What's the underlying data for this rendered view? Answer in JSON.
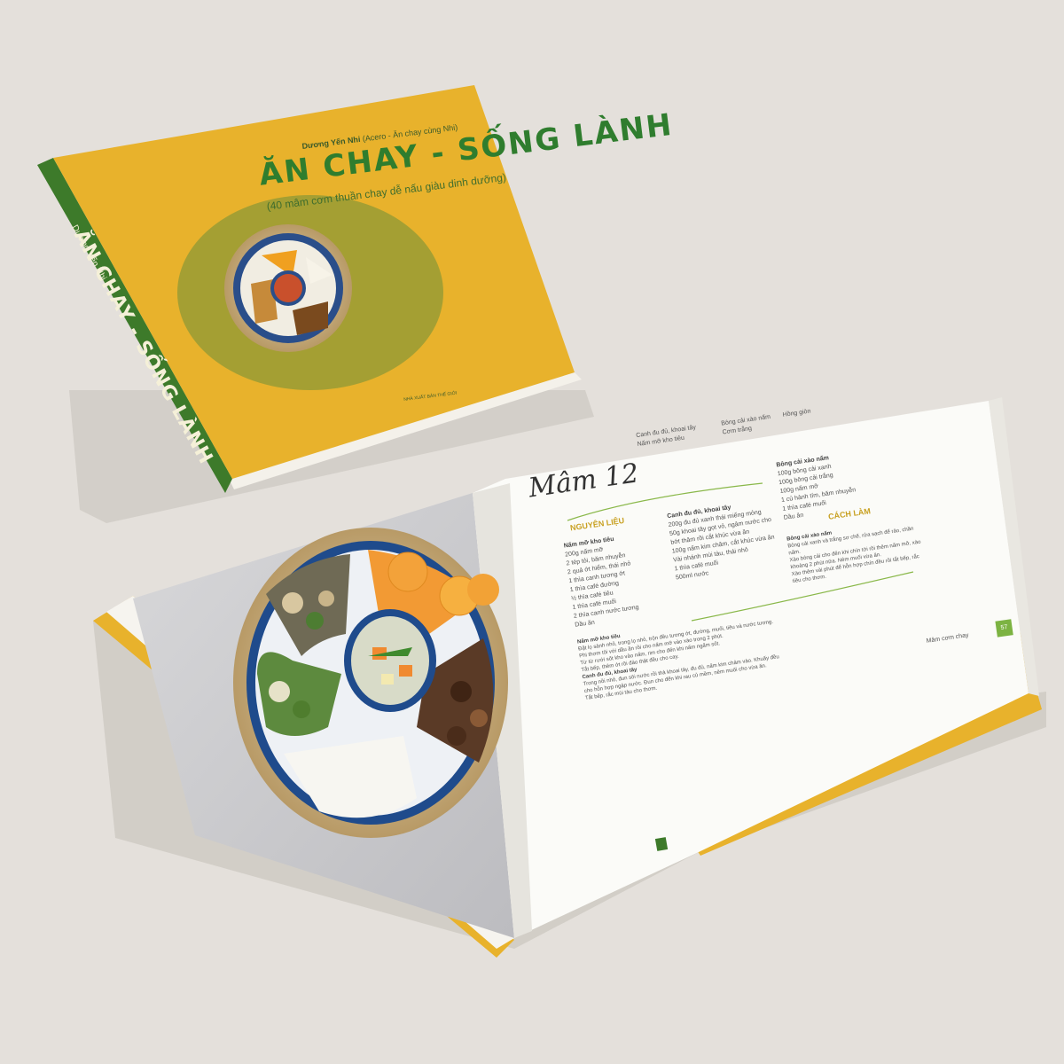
{
  "cover": {
    "author": "Dương Yến Nhi",
    "author_note": "(Acero - Ăn chay cùng Nhi)",
    "title": "ĂN CHAY - SỐNG LÀNH",
    "subtitle": "(40 mâm cơm thuần chay dễ nấu giàu dinh dưỡng)",
    "publisher": "NHÀ XUẤT BẢN THẾ GIỚI"
  },
  "spine": {
    "author": "Dương Yến Nhi",
    "title": "ĂN CHAY - SỐNG LÀNH"
  },
  "recipe_page": {
    "menu_col1": [
      "Canh đu đủ, khoai tây",
      "Nấm mỡ kho tiêu"
    ],
    "menu_col2": [
      "Bông cải xào nấm",
      "Cơm trắng"
    ],
    "menu_col3": [
      "Hồng giòn"
    ],
    "title": "Mâm 12",
    "section_ingredients": "NGUYÊN LIỆU",
    "section_method": "CÁCH LÀM",
    "ing1_title": "Nấm mỡ kho tiêu",
    "ing1": [
      "200g nấm mỡ",
      "2 tép tỏi, băm nhuyễn",
      "2 quả ớt hiểm, thái nhỏ",
      "1 thìa canh tương ớt",
      "1 thìa café đường",
      "½ thìa café tiêu",
      "1 thìa café muối",
      "2 thìa canh nước tương",
      "Dầu ăn"
    ],
    "ing2_title": "Canh đu đủ, khoai tây",
    "ing2": [
      "200g đu đủ xanh thái miếng mỏng",
      "50g khoai tây gọt vỏ, ngâm nước cho bớt thâm rồi cắt khúc vừa ăn",
      "100g nấm kim châm, cắt khúc vừa ăn",
      "Vài nhánh mùi tàu, thái nhỏ",
      "1 thìa café muối",
      "500ml nước"
    ],
    "ing3_title": "Bông cải xào nấm",
    "ing3": [
      "100g bông cải xanh",
      "100g bông cải trắng",
      "100g nấm mỡ",
      "1 củ hành tím, băm nhuyễn",
      "1 thìa café muối",
      "Dầu ăn"
    ],
    "method_steps": [
      "Nấm mỡ kho tiêu",
      "Đặt lọ sành nhỏ, trong lọ nhỏ, trộn đều tương ớt, đường, muối, tiêu và nước tương.",
      "Phi thơm tỏi với dầu ăn rồi cho nấm mỡ vào xào trong 2 phút.",
      "Từ từ rưới sốt kho vào nấm, rim cho đến khi nấm ngấm sốt.",
      "Tắt bếp, thêm ớt rồi đảo thật đều cho cay.",
      "Canh đu đủ, khoai tây",
      "Trong nồi nhỏ, đun sôi nước rồi thả khoai tây, đu đủ, nấm kim châm vào. Khuấy đều cho hỗn hợp ngập nước. Đun cho đến khi rau củ mềm, nêm muối cho vừa ăn.",
      "Tắt bếp, rắc mùi tàu cho thơm."
    ],
    "method3_title": "Bông cải xào nấm",
    "method3": [
      "Bông cải xanh và trắng sơ chế, rửa sạch để ráo, chần nấm.",
      "Xào bông cải cho đến khi chín tới rồi thêm nấm mỡ, xào khoảng 2 phút nữa. Nêm muối vừa ăn.",
      "Xào thêm vài phút để hỗn hợp chín đều rồi tắt bếp, rắc tiêu cho thơm."
    ],
    "footer": "Mâm cơm chay",
    "page_number": "57"
  },
  "colors": {
    "background": "#e4e0db",
    "cover_yellow": "#e8b22c",
    "spine_green": "#3d7a2a",
    "title_green": "#2f7d2e"
  }
}
